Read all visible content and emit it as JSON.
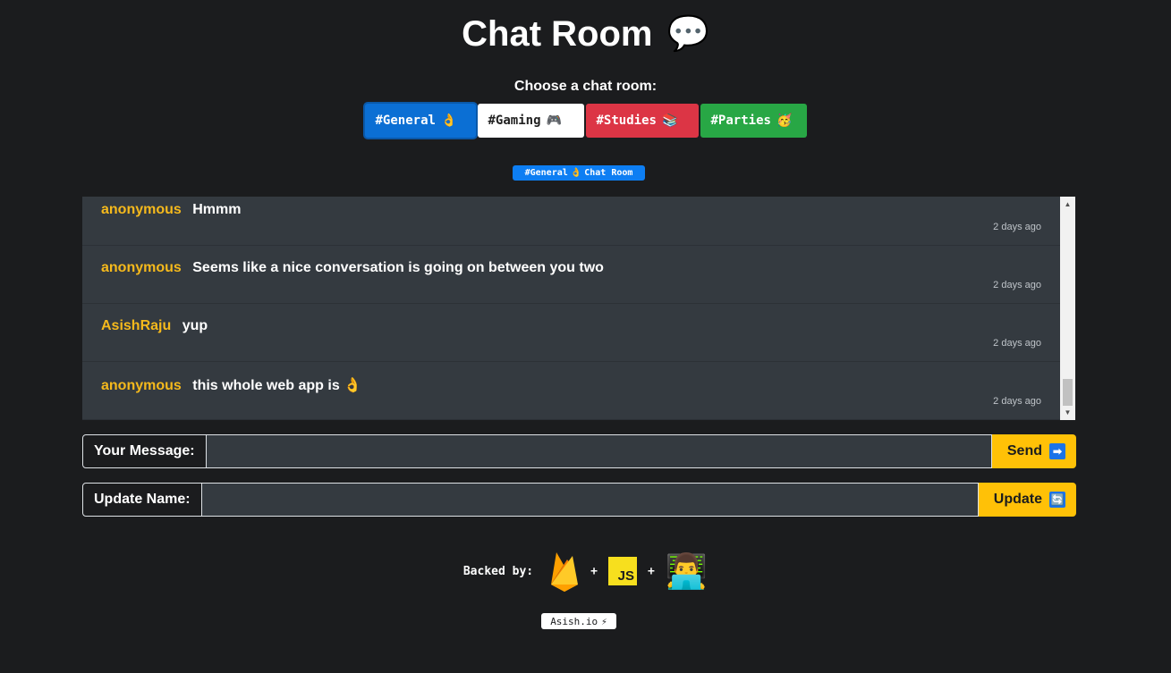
{
  "header": {
    "title": "Chat Room",
    "title_emoji": "💬",
    "choose_label": "Choose a chat room:"
  },
  "rooms": [
    {
      "label": "#General",
      "emoji": "👌"
    },
    {
      "label": "#Gaming",
      "emoji": "🎮"
    },
    {
      "label": "#Studies",
      "emoji": "📚"
    },
    {
      "label": "#Parties",
      "emoji": "🥳"
    }
  ],
  "active_room_badge": {
    "label": "#General",
    "emoji": "👌",
    "suffix": "Chat Room"
  },
  "messages": [
    {
      "user": "anonymous",
      "text": "Hmmm",
      "time": "2 days ago"
    },
    {
      "user": "anonymous",
      "text": "Seems like a nice conversation is going on between you two",
      "time": "2 days ago"
    },
    {
      "user": "AsishRaju",
      "text": "yup",
      "time": "2 days ago"
    },
    {
      "user": "anonymous",
      "text": "this whole web app is 👌",
      "time": "2 days ago"
    }
  ],
  "message_form": {
    "label": "Your Message:",
    "value": "",
    "button_label": "Send",
    "button_icon": "➡"
  },
  "name_form": {
    "label": "Update Name:",
    "value": "",
    "button_label": "Update",
    "button_icon": "🔄"
  },
  "footer": {
    "backed_label": "Backed by:",
    "plus": "+",
    "js_badge": "JS",
    "dev_emoji": "👨‍💻",
    "signature": "Asish.io",
    "signature_emoji": "⚡"
  },
  "colors": {
    "background": "#1b1c1e",
    "accent": "#ffc107",
    "username": "#f5b91c",
    "general": "#0b6fd4",
    "studies": "#dc3545",
    "parties": "#28a745"
  }
}
